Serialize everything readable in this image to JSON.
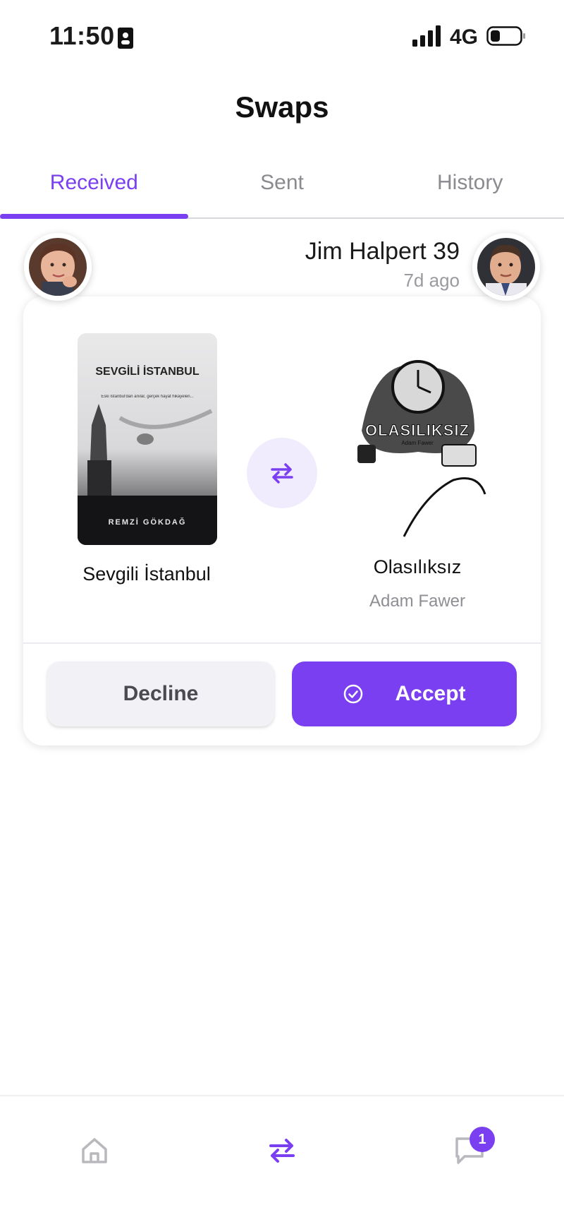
{
  "status_bar": {
    "time": "11:50",
    "network": "4G",
    "icons": [
      "contact-card-icon",
      "signal-icon",
      "battery-icon"
    ]
  },
  "header": {
    "title": "Swaps"
  },
  "tabs": [
    {
      "label": "Received",
      "active": true
    },
    {
      "label": "Sent",
      "active": false
    },
    {
      "label": "History",
      "active": false
    }
  ],
  "swap_request": {
    "user_name": "Jim Halpert 39",
    "time_ago": "7d ago",
    "offered_book": {
      "title": "Sevgili İstanbul",
      "cover_title": "SEVGİLİ İSTANBUL",
      "cover_subtitle": "Eski İstanbul'dan anılar, gerçek hayat hikayeleri...",
      "cover_author": "REMZİ GÖKDAĞ"
    },
    "requested_book": {
      "title": "Olasılıksız",
      "author": "Adam Fawer",
      "cover_title": "OLASILIKSIZ",
      "cover_author": "Adam Fawer"
    },
    "decline_label": "Decline",
    "accept_label": "Accept"
  },
  "bottom_nav": {
    "items": [
      {
        "name": "home-icon",
        "active": false
      },
      {
        "name": "swap-icon",
        "active": true
      },
      {
        "name": "chat-icon",
        "active": false
      }
    ],
    "chat_badge": "1"
  },
  "colors": {
    "accent": "#7b3ff2",
    "muted": "#8a8a8f",
    "swap_circle": "#f1ecfd",
    "decline_bg": "#f2f2f6"
  }
}
